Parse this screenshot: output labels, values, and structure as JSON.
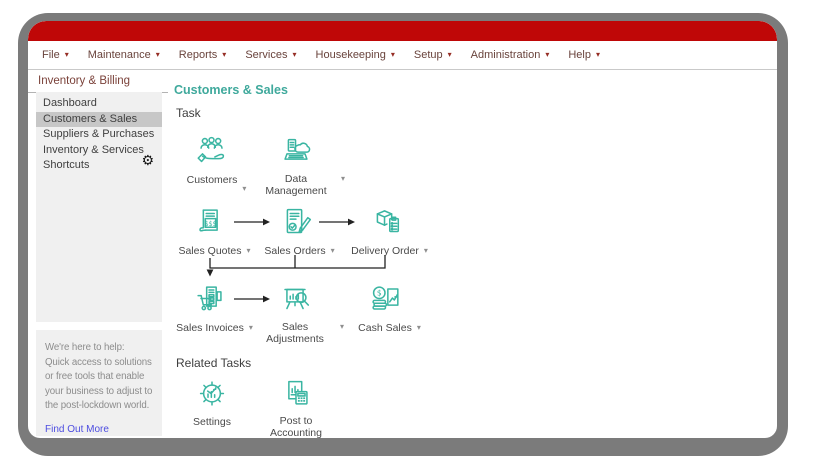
{
  "colors": {
    "brand_red": "#bf0707",
    "accent_teal": "#3fa99c",
    "icon_teal": "#3ab5a2",
    "link_blue": "#4c4ce0",
    "menu_text": "#69433c",
    "frame_gray": "#7b7b7b"
  },
  "menu": {
    "items": [
      {
        "label": "File"
      },
      {
        "label": "Maintenance"
      },
      {
        "label": "Reports"
      },
      {
        "label": "Services"
      },
      {
        "label": "Housekeeping"
      },
      {
        "label": "Setup"
      },
      {
        "label": "Administration"
      },
      {
        "label": "Help"
      }
    ]
  },
  "sidebar": {
    "title": "Inventory & Billing",
    "items": [
      {
        "label": "Dashboard",
        "selected": false
      },
      {
        "label": "Customers & Sales",
        "selected": true
      },
      {
        "label": "Suppliers & Purchases",
        "selected": false
      },
      {
        "label": "Inventory & Services",
        "selected": false
      },
      {
        "label": "Shortcuts",
        "selected": false,
        "icon": "gear-icon"
      }
    ],
    "help": {
      "heading": "We're here to help:",
      "body": "Quick access to solutions or free tools that enable your business to adjust to the post-lockdown world.",
      "link": "Find Out More"
    }
  },
  "main": {
    "heading": "Customers & Sales",
    "sections": {
      "task": "Task",
      "related": "Related Tasks"
    },
    "tasks": {
      "customers": {
        "label": "Customers",
        "icon": "customers-icon",
        "dropdown": true
      },
      "data_management": {
        "label": "Data Management",
        "icon": "data-management-icon",
        "dropdown": true
      },
      "sales_quotes": {
        "label": "Sales Quotes",
        "icon": "sales-quotes-icon",
        "dropdown": true
      },
      "sales_orders": {
        "label": "Sales Orders",
        "icon": "sales-orders-icon",
        "dropdown": true
      },
      "delivery_order": {
        "label": "Delivery Order",
        "icon": "delivery-order-icon",
        "dropdown": true
      },
      "sales_invoices": {
        "label": "Sales Invoices",
        "icon": "sales-invoices-icon",
        "dropdown": true
      },
      "sales_adjustments": {
        "label": "Sales Adjustments",
        "icon": "sales-adjustments-icon",
        "dropdown": true
      },
      "cash_sales": {
        "label": "Cash Sales",
        "icon": "cash-sales-icon",
        "dropdown": true
      },
      "settings": {
        "label": "Settings",
        "icon": "settings-icon",
        "dropdown": false
      },
      "post_to_accounting": {
        "label": "Post to Accounting",
        "icon": "post-to-accounting-icon",
        "dropdown": false
      }
    }
  }
}
